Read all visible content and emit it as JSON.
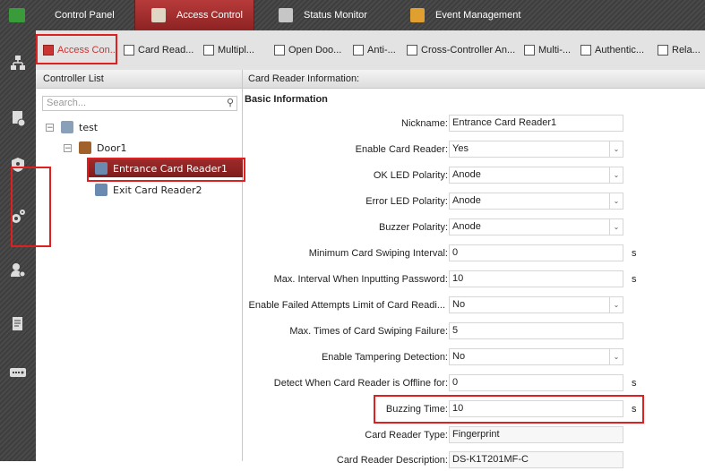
{
  "top_tabs": [
    {
      "label": "Control Panel",
      "icon": "grid-icon",
      "color": "#3a9b3a"
    },
    {
      "label": "Access Control",
      "icon": "door-icon",
      "color": "#e0d6c4"
    },
    {
      "label": "Status Monitor",
      "icon": "monitor-icon",
      "color": "#c6c6c6"
    },
    {
      "label": "Event Management",
      "icon": "event-icon",
      "color": "#e0a030"
    }
  ],
  "toolbar": {
    "items": [
      "Access Con...",
      "Card Read...",
      "Multipl...",
      "Open Doo...",
      "Anti-...",
      "Cross-Controller An...",
      "Multi-...",
      "Authentic...",
      "Rela..."
    ]
  },
  "controller_list": {
    "title": "Controller List",
    "search_placeholder": "Search...",
    "search_icon": "⚲",
    "tree": {
      "root": "test",
      "door": "Door1",
      "reader1": "Entrance Card Reader1",
      "reader2": "Exit Card Reader2"
    }
  },
  "info": {
    "header": "Card Reader Information:",
    "section": "Basic Information",
    "fields": [
      {
        "label": "Nickname:",
        "value": "Entrance Card Reader1",
        "unit": ""
      },
      {
        "label": "Enable Card Reader:",
        "value": "Yes",
        "unit": ""
      },
      {
        "label": "OK LED Polarity:",
        "value": "Anode",
        "unit": ""
      },
      {
        "label": "Error LED Polarity:",
        "value": "Anode",
        "unit": ""
      },
      {
        "label": "Buzzer Polarity:",
        "value": "Anode",
        "unit": ""
      },
      {
        "label": "Minimum Card Swiping Interval:",
        "value": "0",
        "unit": "s"
      },
      {
        "label": "Max. Interval When Inputting Password:",
        "value": "10",
        "unit": "s"
      },
      {
        "label": "Enable Failed Attempts Limit of Card Readi...",
        "value": "No",
        "unit": ""
      },
      {
        "label": "Max. Times of Card Swiping Failure:",
        "value": "5",
        "unit": ""
      },
      {
        "label": "Enable Tampering Detection:",
        "value": "No",
        "unit": ""
      },
      {
        "label": "Detect When Card Reader is Offline for:",
        "value": "0",
        "unit": "s"
      },
      {
        "label": "Buzzing Time:",
        "value": "10",
        "unit": "s"
      },
      {
        "label": "Card Reader Type:",
        "value": "Fingerprint",
        "unit": ""
      },
      {
        "label": "Card Reader Description:",
        "value": "DS-K1T201MF-C",
        "unit": ""
      }
    ]
  },
  "colors": {
    "accent": "#e02020",
    "selected_row": "#8d2323",
    "chrome_dark": "#444444"
  }
}
